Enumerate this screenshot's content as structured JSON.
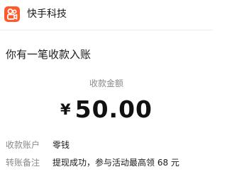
{
  "header": {
    "brand_name": "快手科技",
    "logo_icon": "kuaishou-logo-icon",
    "accent_color": "#ff5a2e"
  },
  "headline": "你有一笔收款入账",
  "amount": {
    "label": "收款金额",
    "currency": "¥",
    "value": "50.00"
  },
  "details": [
    {
      "key": "收款账户",
      "value": "零钱"
    },
    {
      "key": "转账备注",
      "value": "提现成功，参与活动最高领 68 元"
    }
  ]
}
